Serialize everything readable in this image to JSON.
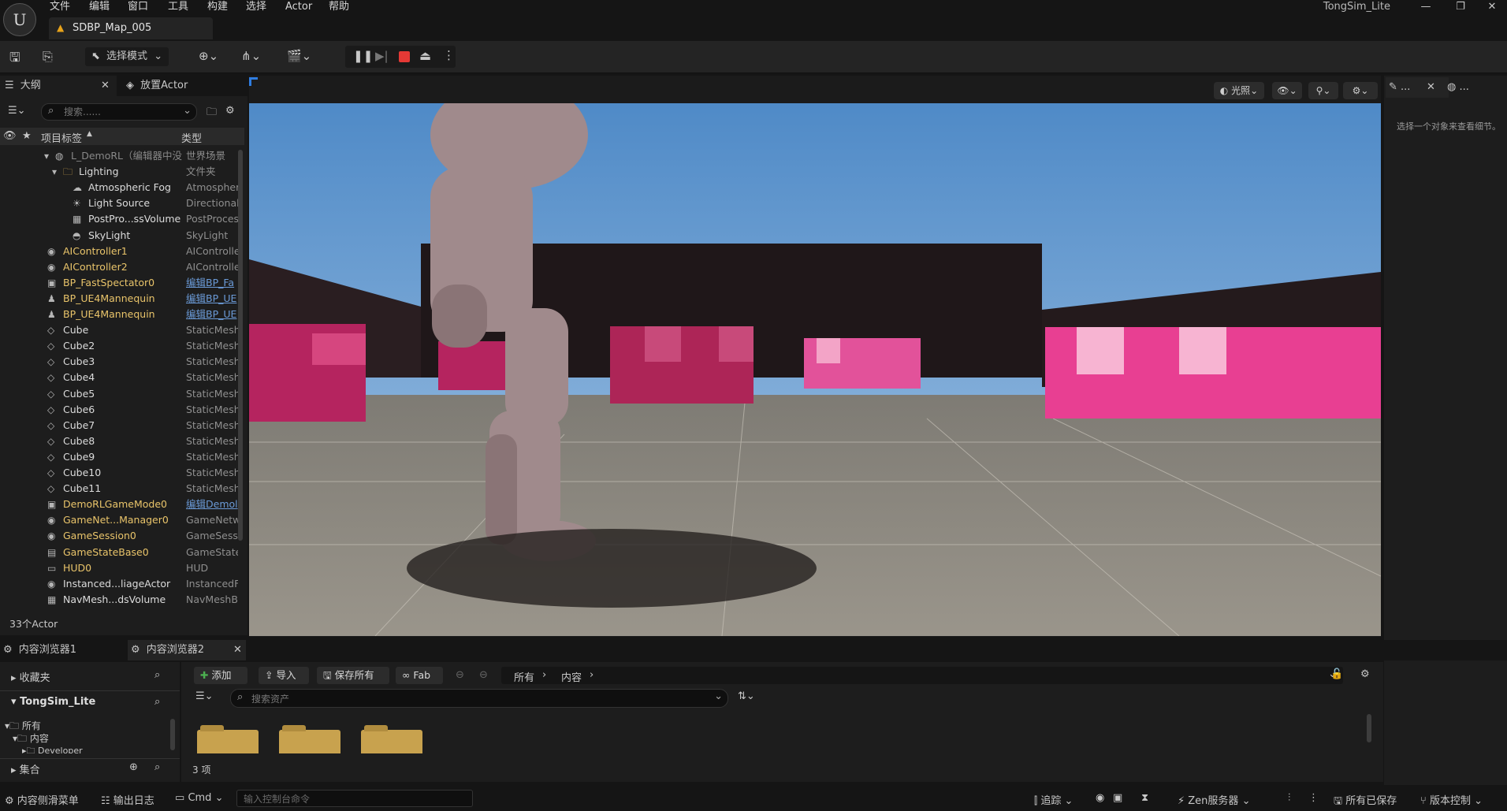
{
  "menubar": {
    "items": [
      "文件",
      "编辑",
      "窗口",
      "工具",
      "构建",
      "选择",
      "Actor",
      "帮助"
    ],
    "app_title": "TongSim_Lite"
  },
  "document_tab": {
    "label": "SDBP_Map_005"
  },
  "toolbar": {
    "mode_label": "选择模式"
  },
  "outliner": {
    "tabs": {
      "outline": "大纲",
      "place_actor": "放置Actor"
    },
    "search_placeholder": "搜索......",
    "columns": {
      "label": "项目标签",
      "type": "类型"
    },
    "rows": [
      {
        "name": "L_DemoRL（编辑器中没",
        "type": "世界场景",
        "icon": "world-icon"
      },
      {
        "name": "Lighting",
        "type": "文件夹",
        "icon": "folder-icon"
      },
      {
        "name": "Atmospheric Fog",
        "type": "Atmospher",
        "icon": "fog-icon"
      },
      {
        "name": "Light Source",
        "type": "Directionali",
        "icon": "sun-icon"
      },
      {
        "name": "PostPro...ssVolume",
        "type": "PostProces",
        "icon": "volume-icon"
      },
      {
        "name": "SkyLight",
        "type": "SkyLight",
        "icon": "skylight-icon"
      },
      {
        "name": "AIController1",
        "type": "AIControlle",
        "icon": "controller-icon"
      },
      {
        "name": "AIController2",
        "type": "AIControlle",
        "icon": "controller-icon"
      },
      {
        "name": "BP_FastSpectator0",
        "type": "编辑BP_Fa",
        "icon": "blueprint-icon"
      },
      {
        "name": "BP_UE4Mannequin",
        "type": "编辑BP_UE",
        "icon": "pawn-icon"
      },
      {
        "name": "BP_UE4Mannequin",
        "type": "编辑BP_UE",
        "icon": "pawn-icon"
      },
      {
        "name": "Cube",
        "type": "StaticMesh",
        "icon": "mesh-icon"
      },
      {
        "name": "Cube2",
        "type": "StaticMesh",
        "icon": "mesh-icon"
      },
      {
        "name": "Cube3",
        "type": "StaticMesh",
        "icon": "mesh-icon"
      },
      {
        "name": "Cube4",
        "type": "StaticMesh",
        "icon": "mesh-icon"
      },
      {
        "name": "Cube5",
        "type": "StaticMesh",
        "icon": "mesh-icon"
      },
      {
        "name": "Cube6",
        "type": "StaticMesh",
        "icon": "mesh-icon"
      },
      {
        "name": "Cube7",
        "type": "StaticMesh",
        "icon": "mesh-icon"
      },
      {
        "name": "Cube8",
        "type": "StaticMesh",
        "icon": "mesh-icon"
      },
      {
        "name": "Cube9",
        "type": "StaticMesh",
        "icon": "mesh-icon"
      },
      {
        "name": "Cube10",
        "type": "StaticMesh",
        "icon": "mesh-icon"
      },
      {
        "name": "Cube11",
        "type": "StaticMesh",
        "icon": "mesh-icon"
      },
      {
        "name": "DemoRLGameMode0",
        "type": "编辑Demol",
        "icon": "gamemode-icon"
      },
      {
        "name": "GameNet...Manager0",
        "type": "GameNetw",
        "icon": "actor-icon"
      },
      {
        "name": "GameSession0",
        "type": "GameSess",
        "icon": "actor-icon"
      },
      {
        "name": "GameStateBase0",
        "type": "GameState",
        "icon": "gamestate-icon"
      },
      {
        "name": "HUD0",
        "type": "HUD",
        "icon": "hud-icon"
      },
      {
        "name": "Instanced...liageActor",
        "type": "InstancedF",
        "icon": "actor-icon"
      },
      {
        "name": "NavMesh...dsVolume",
        "type": "NavMeshB",
        "icon": "volume-icon"
      }
    ],
    "footer": "33个Actor"
  },
  "viewport": {
    "lighting_label": "光照"
  },
  "details": {
    "tab1": "...",
    "tab2": "...",
    "empty_message": "选择一个对象来查看细节。"
  },
  "content_browser": {
    "tabs": [
      "内容浏览器1",
      "内容浏览器2"
    ],
    "favorites": "收藏夹",
    "project": "TongSim_Lite",
    "tree": [
      "所有",
      "内容",
      "Developer"
    ],
    "collections": "集合",
    "add": "添加",
    "import": "导入",
    "save_all": "保存所有",
    "fab": "Fab",
    "path": [
      "所有",
      "内容"
    ],
    "search_placeholder": "搜索资产",
    "item_count": "3 项"
  },
  "statusbar": {
    "drawer": "内容侧滑菜单",
    "output_log": "输出日志",
    "cmd": "Cmd",
    "console_placeholder": "输入控制台命令",
    "trace": "追踪",
    "zen": "Zen服务器",
    "saved": "所有已保存",
    "source_control": "版本控制"
  },
  "colors": {
    "accent_stop": "#e53935",
    "link": "#6b9bd8",
    "highlight_yellow": "#e9c46a",
    "folder": "#c8a24e"
  }
}
